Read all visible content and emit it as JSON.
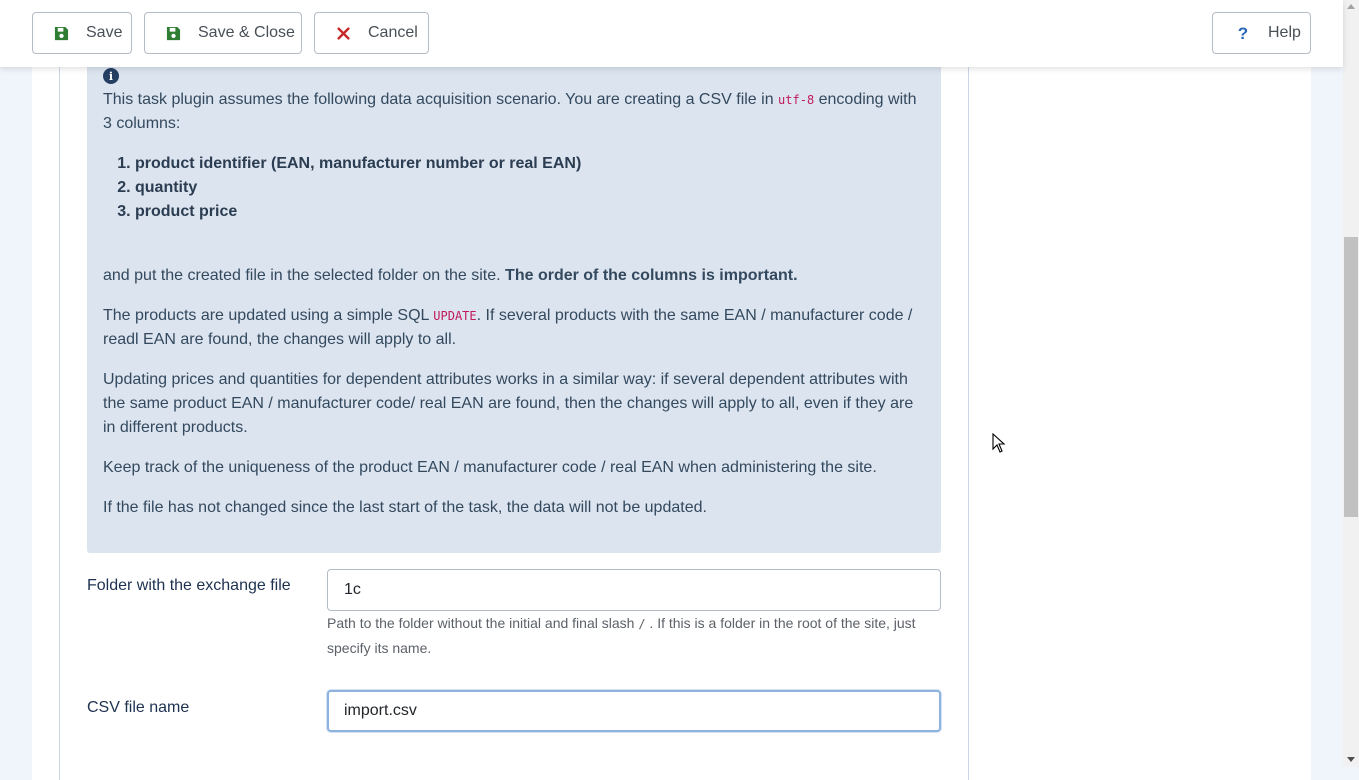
{
  "toolbar": {
    "save_label": "Save",
    "save_close_label": "Save & Close",
    "cancel_label": "Cancel",
    "help_label": "Help"
  },
  "icons": {
    "save": "floppy-disk-icon",
    "cancel": "close-icon",
    "help": "question-icon",
    "info": "info-icon"
  },
  "colors": {
    "accent_icon": "#2e7d32",
    "danger": "#c52827",
    "help": "#2a69b8",
    "alert_bg": "#dbe4ef"
  },
  "alert": {
    "intro_text": "This task plugin assumes the following data acquisition scenario. You are creating a CSV file in ",
    "intro_code": "utf-8",
    "intro_text_2": " encoding with 3 columns:",
    "columns": [
      "product identifier (EAN, manufacturer number or real EAN)",
      "quantity",
      "product price"
    ],
    "put_text": "and put the created file in the selected folder on the site. ",
    "put_bold": "The order of the columns is important.",
    "update_text_1": "The products are updated using a simple SQL ",
    "update_code": "UPDATE",
    "update_text_2": ". If several products with the same EAN / manufacturer code / readl EAN are found, the changes will apply to all.",
    "attributes_text": "Updating prices and quantities for dependent attributes works in a similar way: if several dependent attributes with the same product EAN / manufacturer code/ real EAN are found, then the changes will apply to all, even if they are in different products.",
    "warning_1": "Keep track of the uniqueness of the product EAN / manufacturer code / real EAN when administering the site.",
    "warning_2": "If the file has not changed since the last start of the task, the data will not be updated."
  },
  "form": {
    "folder_label": "Folder with the exchange file",
    "folder_value": "1c",
    "folder_help_1": "Path to the folder without the initial and final slash ",
    "folder_help_code": "/",
    "folder_help_2": " . If this is a folder in the root of the site, just specify its name.",
    "csv_label": "CSV file name",
    "csv_value": "import.csv"
  }
}
